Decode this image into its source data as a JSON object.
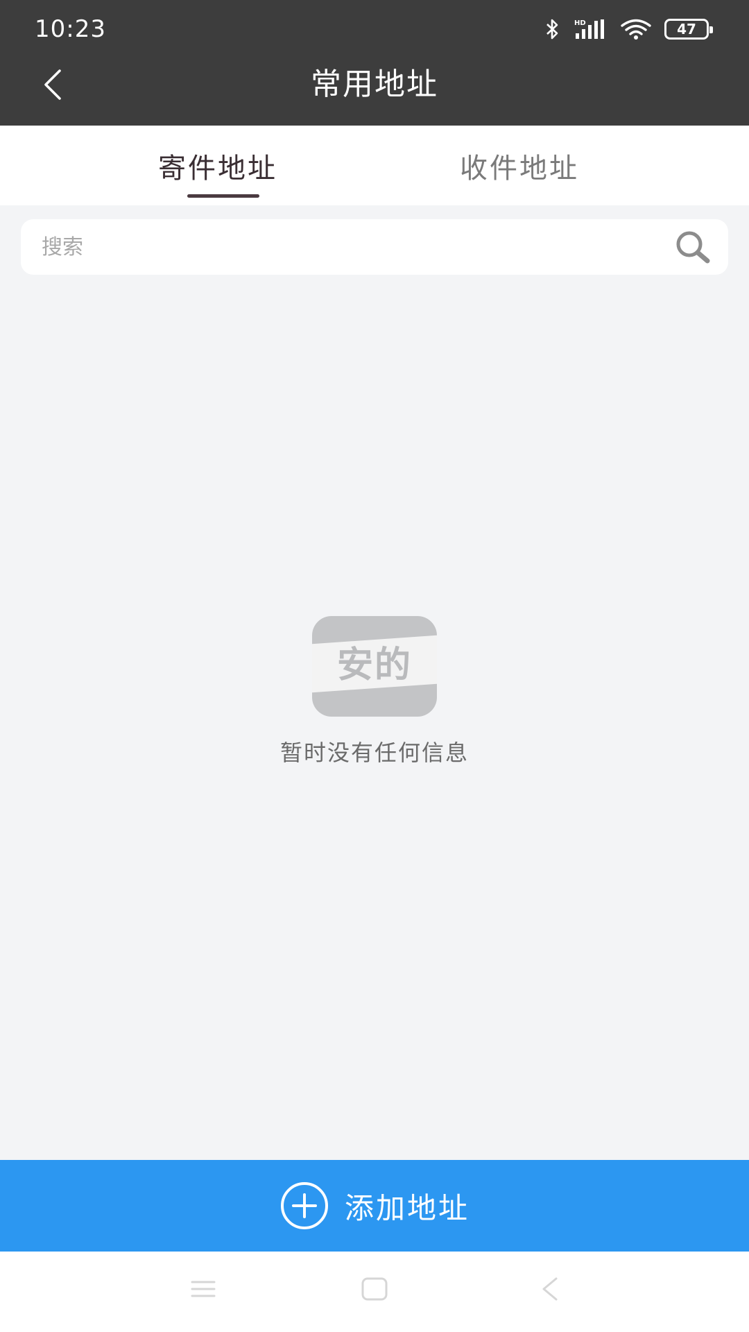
{
  "status_bar": {
    "time": "10:23",
    "battery": "47",
    "icons": [
      "bluetooth-icon",
      "signal-icon",
      "wifi-icon",
      "battery-icon"
    ]
  },
  "header": {
    "title": "常用地址",
    "back_icon": "chevron-left-icon"
  },
  "tabs": [
    {
      "label": "寄件地址",
      "active": true
    },
    {
      "label": "收件地址",
      "active": false
    }
  ],
  "search": {
    "placeholder": "搜索",
    "value": ""
  },
  "empty_state": {
    "logo_text": "安的",
    "message": "暂时没有任何信息"
  },
  "add_button": {
    "label": "添加地址"
  },
  "colors": {
    "header_bg": "#3d3d3d",
    "accent_blue": "#2c97f1",
    "page_bg": "#f3f4f6",
    "tab_active": "#3a2e33",
    "tab_inactive": "#7a7a7a"
  },
  "nav_bar": [
    "menu-icon",
    "home-icon",
    "back-icon"
  ]
}
